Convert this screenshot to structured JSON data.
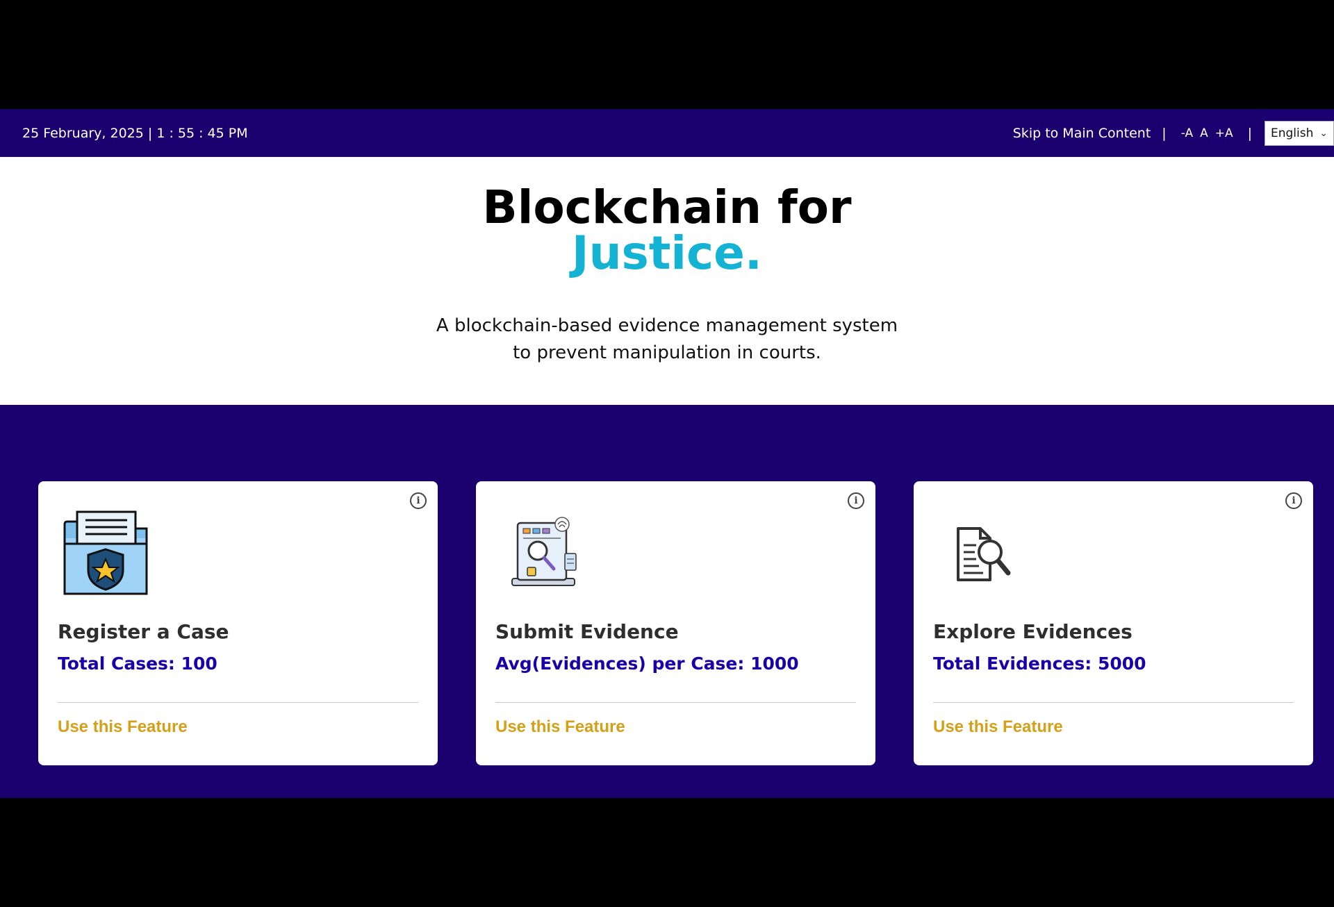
{
  "topbar": {
    "datetime": "25 February, 2025 | 1 : 55 : 45 PM",
    "skip_link": "Skip to Main Content",
    "separator": "|",
    "font_decrease": "-A",
    "font_normal": "A",
    "font_increase": "+A",
    "language": "English"
  },
  "hero": {
    "title_line1": "Blockchain for",
    "title_line2": "Justice.",
    "subtitle": "A blockchain-based evidence management system to prevent manipulation in courts."
  },
  "cards": [
    {
      "icon": "folder-shield-icon",
      "title": "Register a Case",
      "stat": "Total Cases: 100",
      "link": "Use this Feature"
    },
    {
      "icon": "evidence-screen-icon",
      "title": "Submit Evidence",
      "stat": "Avg(Evidences) per Case: 1000",
      "link": "Use this Feature"
    },
    {
      "icon": "document-search-icon",
      "title": "Explore Evidences",
      "stat": "Total Evidences: 5000",
      "link": "Use this Feature"
    }
  ],
  "colors": {
    "primary_navy": "#1a006e",
    "accent_cyan": "#14b3d4",
    "stat_blue": "#1a00a8",
    "link_gold": "#d4a017"
  }
}
